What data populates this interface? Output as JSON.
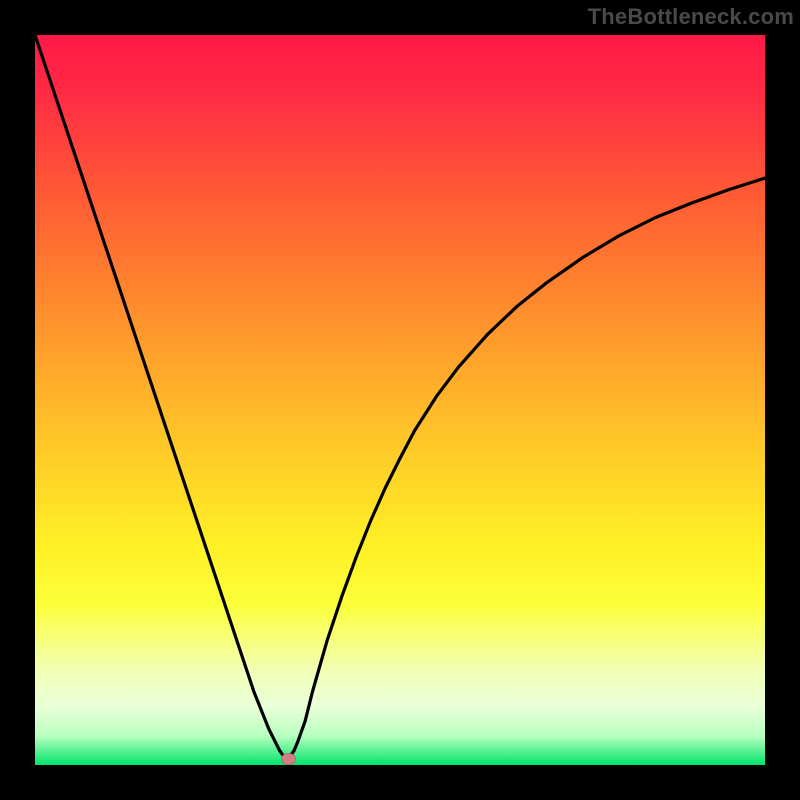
{
  "watermark": "TheBottleneck.com",
  "chart_data": {
    "type": "line",
    "title": "",
    "xlabel": "",
    "ylabel": "",
    "xlim": [
      0,
      100
    ],
    "ylim": [
      0,
      100
    ],
    "grid": false,
    "legend": false,
    "background": "rainbow-vertical",
    "marker": {
      "x": 34.5,
      "y": 1
    },
    "series": [
      {
        "name": "bottleneck-curve",
        "x": [
          0,
          2,
          4,
          6,
          8,
          10,
          12,
          14,
          16,
          18,
          20,
          22,
          24,
          26,
          28,
          29,
          30,
          31,
          32,
          33,
          33.5,
          34,
          34.5,
          35,
          35.5,
          36,
          37,
          38,
          40,
          42,
          44,
          46,
          48,
          50,
          52,
          55,
          58,
          62,
          66,
          70,
          75,
          80,
          85,
          90,
          95,
          100
        ],
        "y": [
          100,
          94,
          88,
          82,
          76,
          70,
          64,
          58,
          52,
          46,
          40,
          34,
          28,
          22,
          16,
          13,
          10,
          7.5,
          5,
          3,
          2,
          1.3,
          1,
          1.3,
          2,
          3.2,
          6,
          10,
          17,
          23,
          28.5,
          33.5,
          38,
          42,
          45.8,
          50.5,
          54.5,
          59,
          62.8,
          66,
          69.5,
          72.5,
          75,
          77,
          78.8,
          80.4
        ]
      }
    ]
  }
}
